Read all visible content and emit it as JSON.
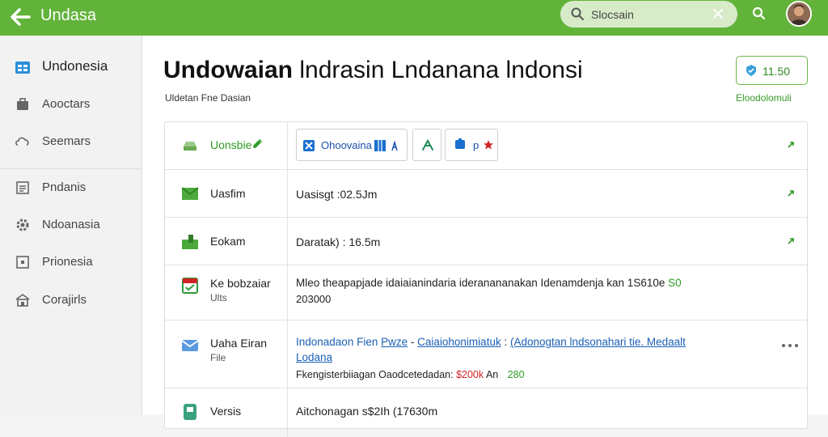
{
  "topbar": {
    "title": "Undasa",
    "search_placeholder": "Slocsain"
  },
  "sidebar": {
    "items": [
      {
        "label": "Undonesia",
        "icon": "grid-icon"
      },
      {
        "label": "Aooctars",
        "icon": "briefcase-icon"
      },
      {
        "label": "Seemars",
        "icon": "cloud-icon"
      },
      {
        "label": "Pndanis",
        "icon": "document-icon"
      },
      {
        "label": "Ndoanasia",
        "icon": "gear-icon"
      },
      {
        "label": "Prionesia",
        "icon": "image-icon"
      },
      {
        "label": "Corajirls",
        "icon": "building-icon"
      }
    ]
  },
  "main": {
    "title_bold": "Undowaian",
    "title_rest": " lndrasin Lndanana lndonsi",
    "subtitle": "Uldetan Fne Dasian",
    "badge": "11.50",
    "badge_caption": "Eloodolomuli"
  },
  "table": {
    "rows": [
      {
        "name": "Uonsbie",
        "buttons": [
          "Ohoovaina",
          "",
          ""
        ]
      },
      {
        "name": "Uasfim",
        "value": "Uasisgt  :02.5Jm"
      },
      {
        "name": "Eokam",
        "value": "Daratak)  :  16.5m"
      },
      {
        "name": "Ke bobzaiar",
        "sub": "Ults",
        "value1": "Mleo theapapjade idaiaianindaria ideranananakan Idenamdenja kan 1S610e",
        "value1_tail": "S0",
        "value2": "203000"
      },
      {
        "name": "Uaha Eiran",
        "sub": "File",
        "link_a": "Indonadaon Fien",
        "link_b": "Pwze",
        "link_c": "Caiaiohonimiatuk",
        "link_d": "(Adonogtan lndsonahari tie. Medaalt",
        "link_e": "Lodana",
        "foot": "Fkengisterbiiagan Oaodcetedadan:",
        "foot_red": "$200k",
        "foot_mid": "An",
        "foot_green": "280"
      },
      {
        "name": "Versis",
        "value": "Aitchonagan s$2Ih (17630m"
      }
    ]
  },
  "colors": {
    "accent": "#62b33a",
    "link": "#1a5fb4",
    "red": "#d02424"
  }
}
